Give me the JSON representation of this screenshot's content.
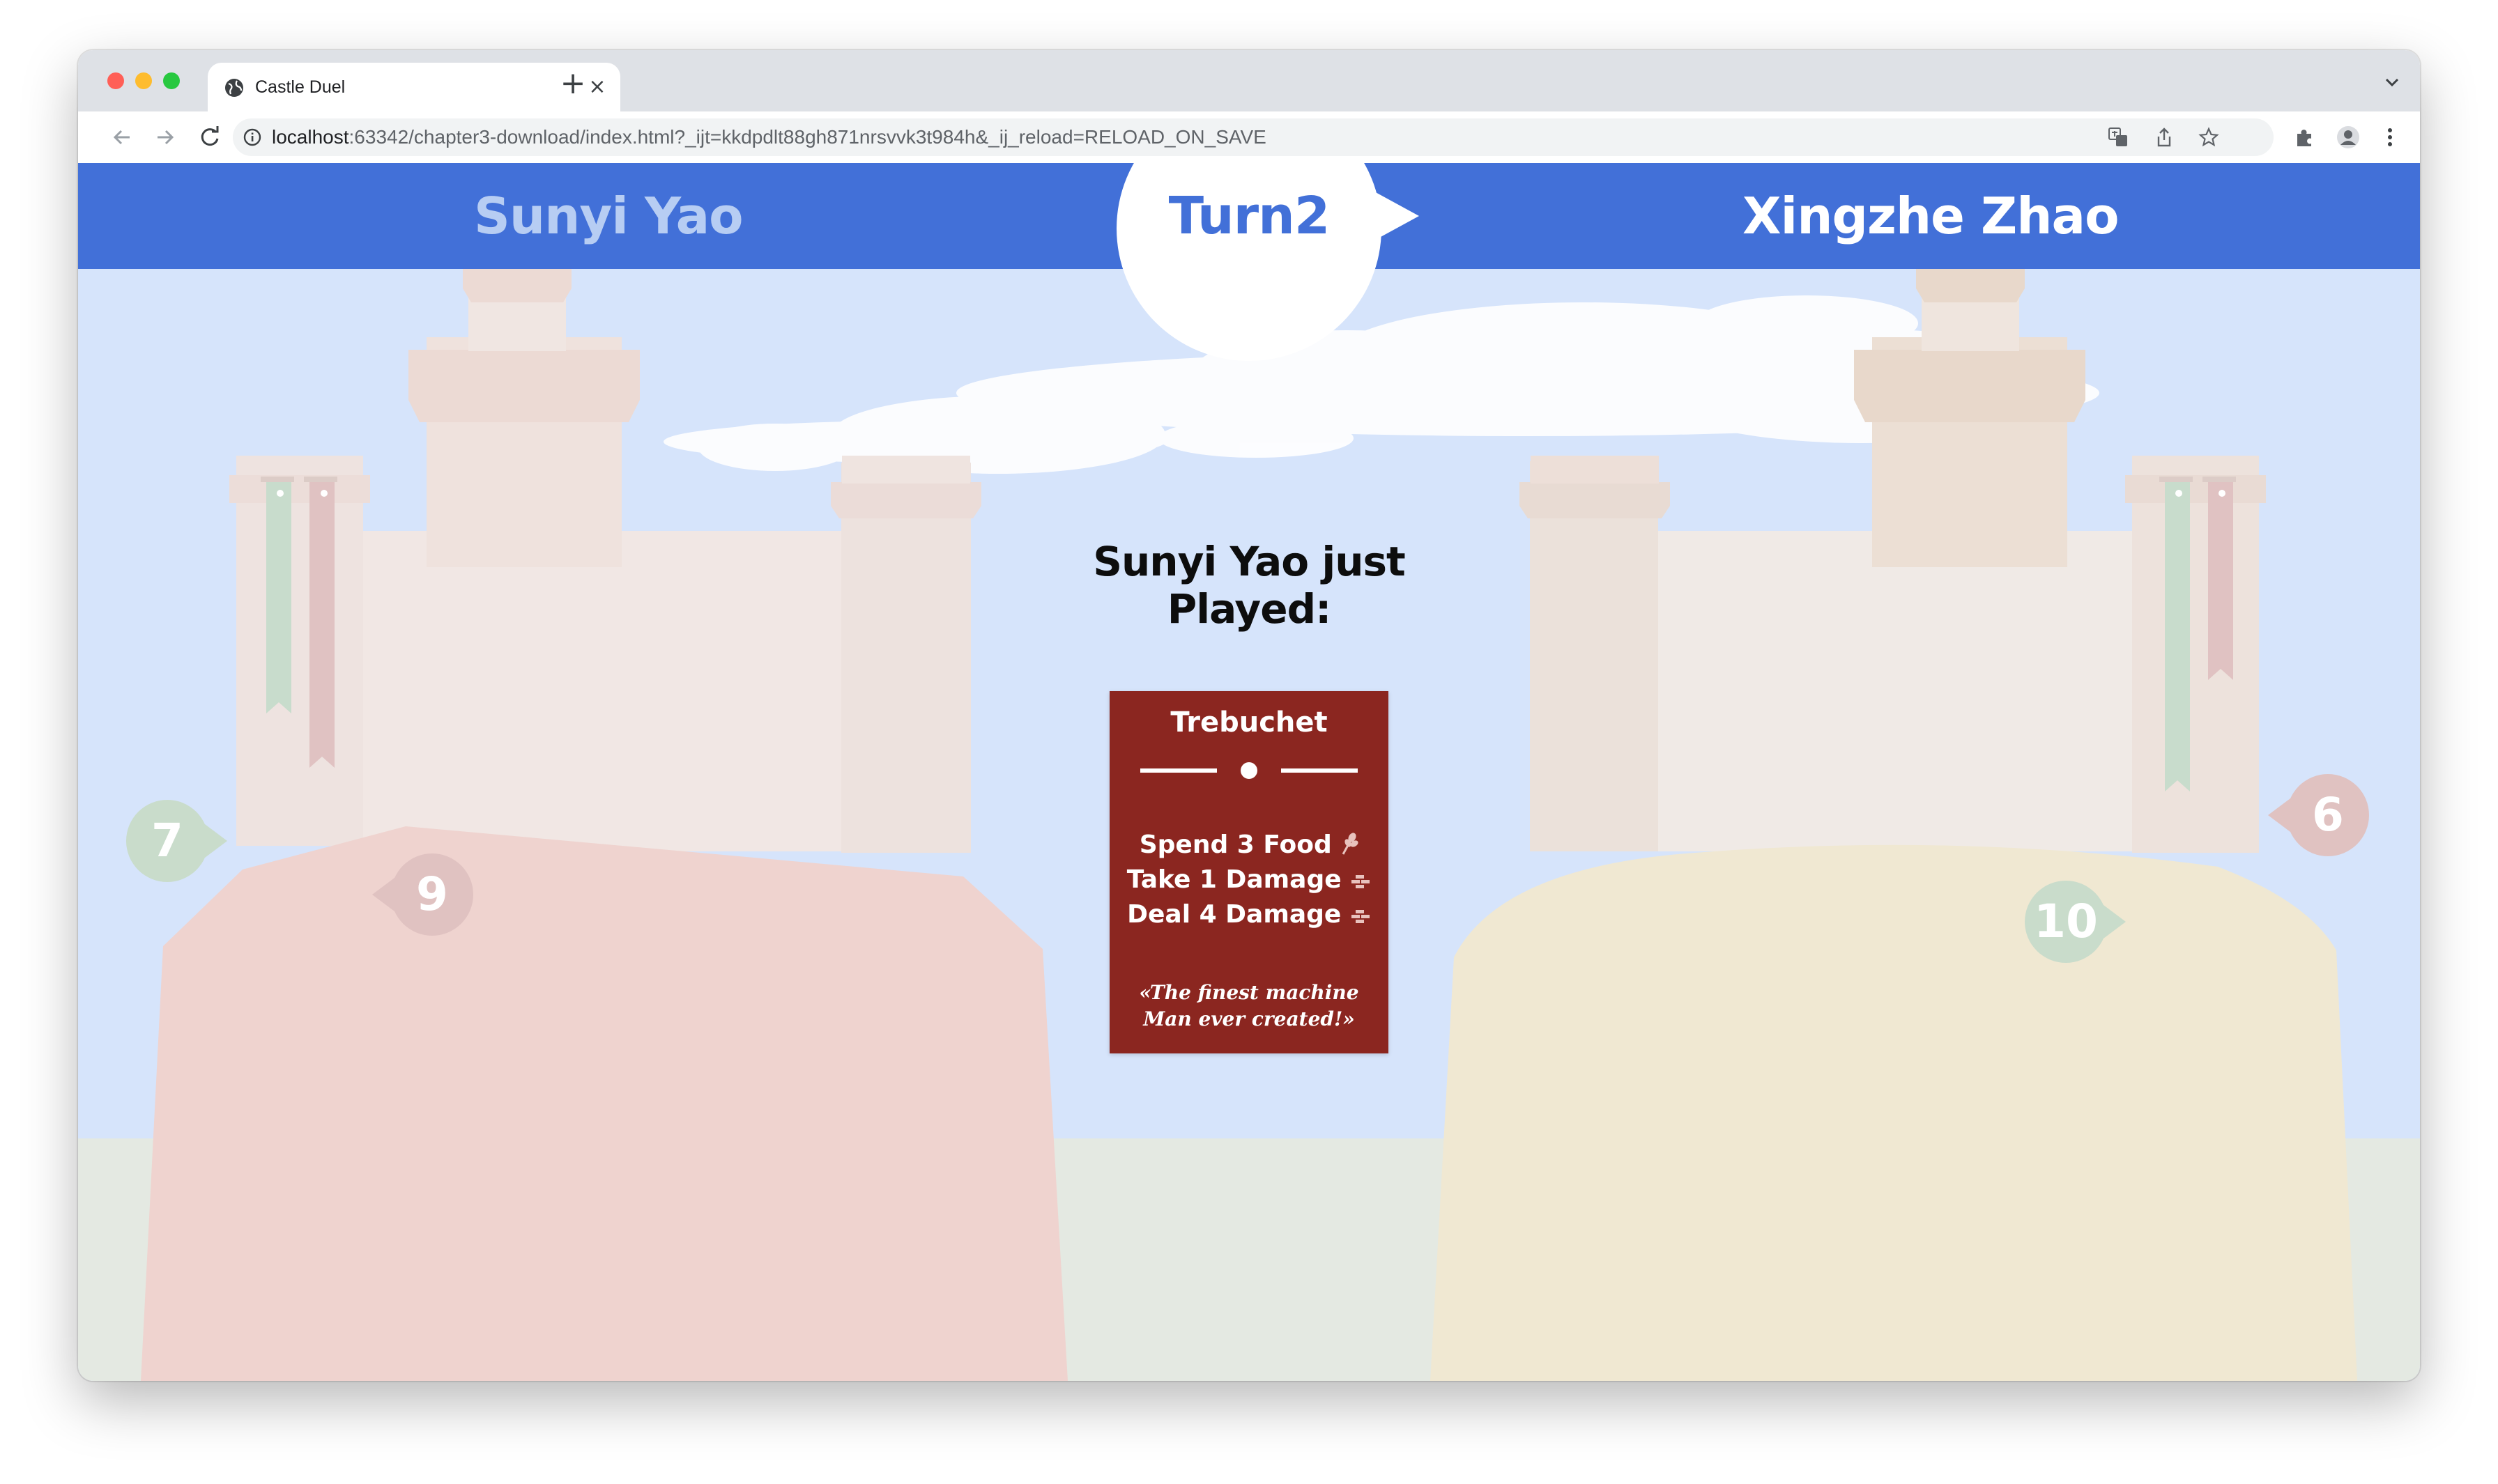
{
  "browser": {
    "tab_title": "Castle Duel",
    "url_host": "localhost",
    "url_rest": ":63342/chapter3-download/index.html?_ijt=kkdpdlt88gh871nrsvvk3t984h&_ij_reload=RELOAD_ON_SAVE"
  },
  "game": {
    "player_left": "Sunyi Yao",
    "player_right": "Xingzhe Zhao",
    "turn": "Turn2",
    "last_played": "Sunyi Yao just Played:",
    "card": {
      "title": "Trebuchet",
      "effects": [
        "Spend 3 Food",
        "Take 1 Damage",
        "Deal 4 Damage"
      ],
      "effect_icons": [
        "food-icon",
        "damage-icon",
        "damage-icon"
      ],
      "flavor": "«The finest machine Man ever created!»"
    },
    "left_castle": {
      "food": "7",
      "health": "9"
    },
    "right_castle": {
      "food": "10",
      "health": "6"
    }
  },
  "colors": {
    "top_bar": "#4270d8",
    "sky": "#d6e4fb",
    "card": "#8b2620",
    "food_bubble": "#c9dccb",
    "health_bubble": "#e0c2c1",
    "left_hill": "#efd3cf",
    "right_hill": "#f0e8d2"
  }
}
